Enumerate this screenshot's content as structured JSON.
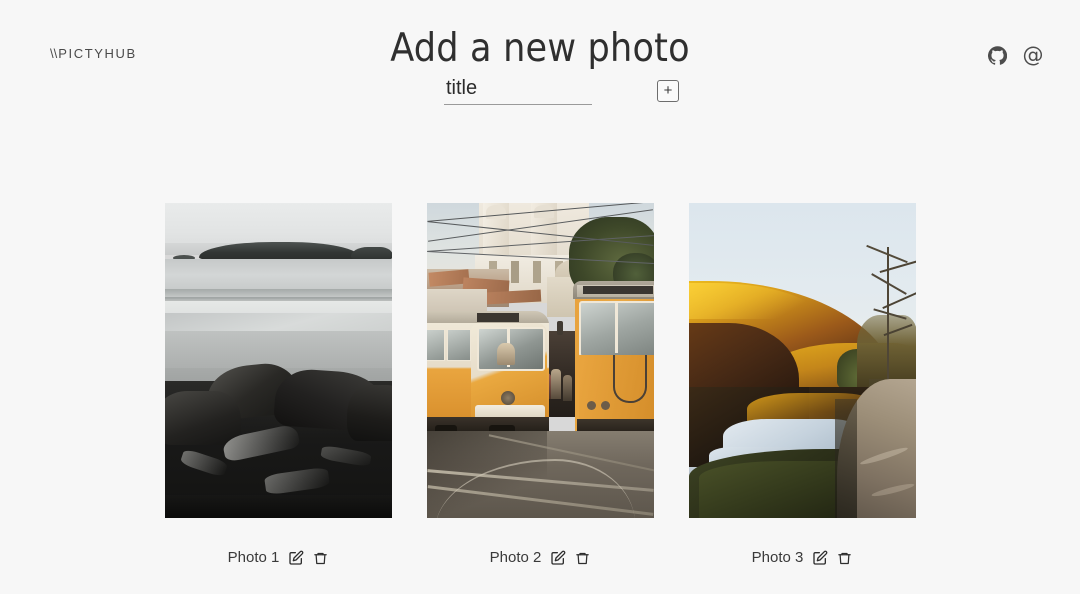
{
  "page": {
    "title": "Add a new photo",
    "background_color": "#f7f7f7",
    "text_color": "#333333"
  },
  "header": {
    "brand": {
      "slashes": "\\\\",
      "name": "PICTYHUB"
    },
    "links": [
      {
        "name": "github-link",
        "icon": "github-icon",
        "label": ""
      },
      {
        "name": "contact-link",
        "icon": "at-icon",
        "label": "@"
      }
    ]
  },
  "form": {
    "title_input": {
      "value": "",
      "placeholder": "title"
    },
    "add_button": {
      "label": "+",
      "icon": "plus-icon"
    }
  },
  "gallery": {
    "photos": [
      {
        "caption": "Photo 1",
        "alt": "black and white beach with distant island and dark rocks",
        "edit_icon": "edit-icon",
        "delete_icon": "trash-icon"
      },
      {
        "caption": "Photo 2",
        "alt": "two yellow trams on a cobblestone street below a white church",
        "edit_icon": "edit-icon",
        "delete_icon": "trash-icon"
      },
      {
        "caption": "Photo 3",
        "alt": "autumn hillside reflected in a lake beside a gravel path",
        "edit_icon": "edit-icon",
        "delete_icon": "trash-icon"
      }
    ]
  }
}
